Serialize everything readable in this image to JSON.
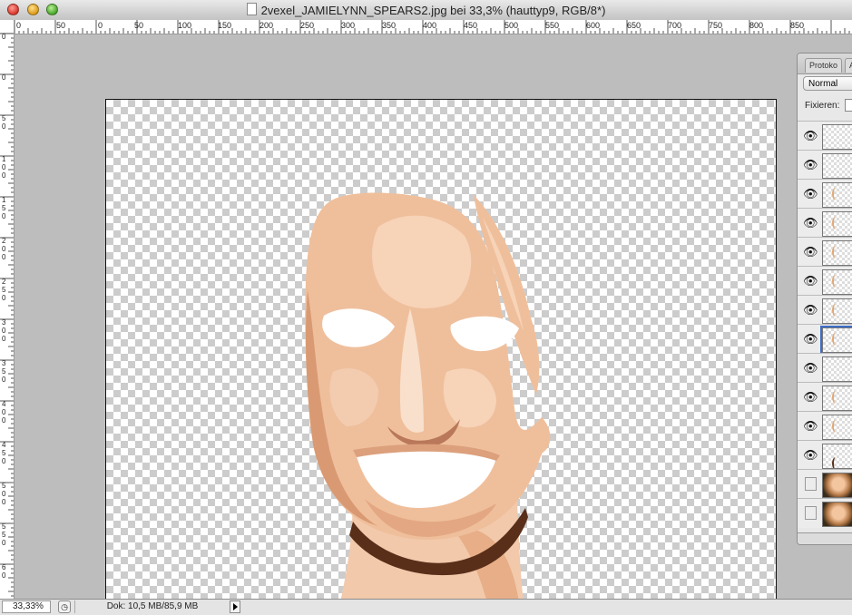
{
  "window": {
    "title": "2vexel_JAMIELYNN_SPEARS2.jpg bei 33,3% (hauttyp9, RGB/8*)"
  },
  "ruler": {
    "top_labels": [
      "0",
      "50",
      "0",
      "50",
      "100",
      "150",
      "200",
      "250",
      "300",
      "350",
      "400",
      "450",
      "500",
      "550",
      "600",
      "650",
      "700",
      "750",
      "800",
      "850"
    ],
    "left_labels": [
      "0",
      "0",
      "5\n0",
      "1\n0\n0",
      "1\n5\n0",
      "2\n0\n0",
      "2\n5\n0",
      "3\n0\n0",
      "3\n5\n0",
      "4\n0\n0",
      "4\n5\n0",
      "5\n0\n0",
      "5\n5\n0",
      "6\n0"
    ]
  },
  "status_bar": {
    "zoom": "33,33%",
    "doc_info": "Dok: 10,5 MB/85,9 MB"
  },
  "layers_panel": {
    "tabs": [
      "Protoko",
      "Ak"
    ],
    "blend_mode": "Normal",
    "lock_label": "Fixieren:",
    "layers": [
      {
        "visible": true,
        "thumb": "transparent"
      },
      {
        "visible": true,
        "thumb": "transparent"
      },
      {
        "visible": true,
        "thumb": "stroke"
      },
      {
        "visible": true,
        "thumb": "stroke"
      },
      {
        "visible": true,
        "thumb": "stroke"
      },
      {
        "visible": true,
        "thumb": "stroke"
      },
      {
        "visible": true,
        "thumb": "stroke"
      },
      {
        "visible": true,
        "thumb": "stroke",
        "selected": true
      },
      {
        "visible": true,
        "thumb": "transparent"
      },
      {
        "visible": true,
        "thumb": "stroke"
      },
      {
        "visible": true,
        "thumb": "stroke"
      },
      {
        "visible": true,
        "thumb": "dark"
      },
      {
        "visible": false,
        "thumb": "photo"
      },
      {
        "visible": false,
        "thumb": "photo"
      }
    ]
  },
  "colors": {
    "skin_light": "#f7d3b8",
    "skin_mid": "#efbf9c",
    "skin_dark": "#d99a73",
    "necklace": "#5a2f1a"
  }
}
